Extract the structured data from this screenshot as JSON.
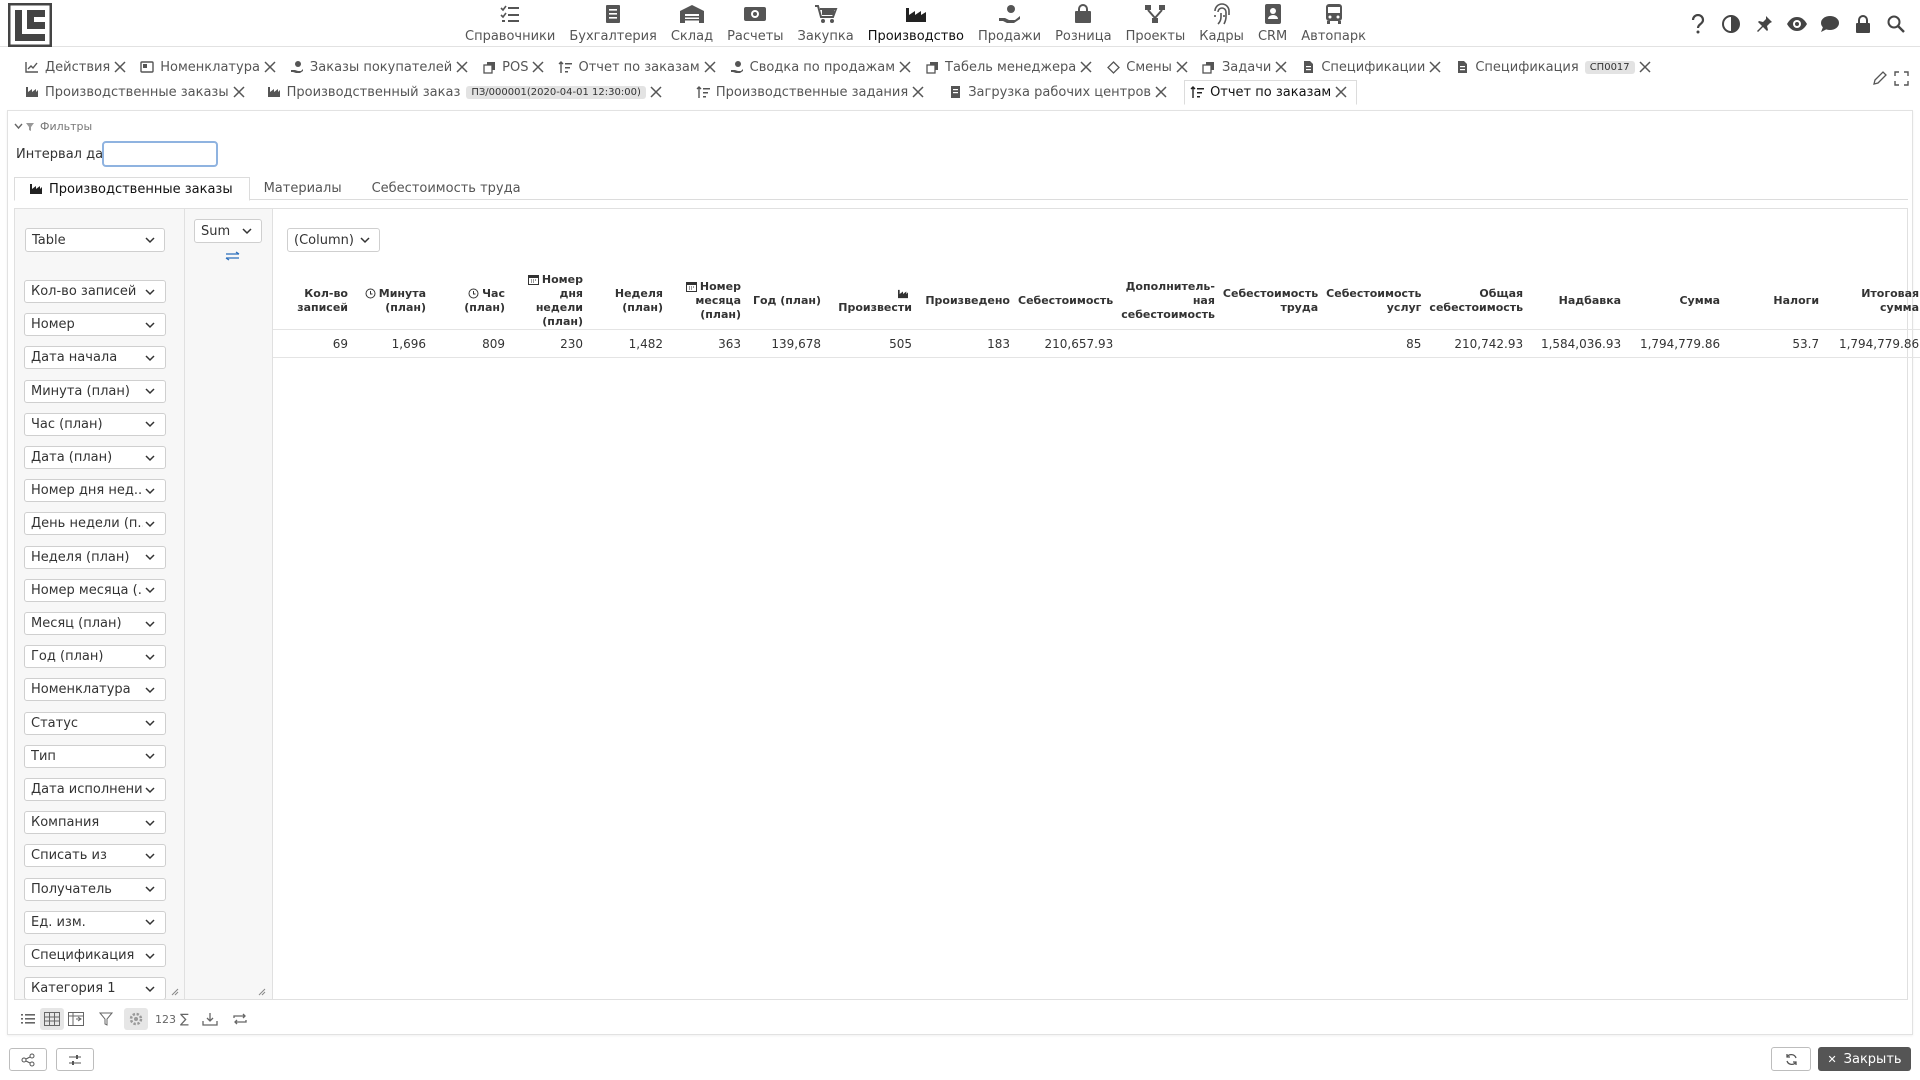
{
  "nav": {
    "items": [
      {
        "label": "Справочники",
        "icon": "list-check-icon"
      },
      {
        "label": "Бухгалтерия",
        "icon": "ledger-icon"
      },
      {
        "label": "Склад",
        "icon": "warehouse-icon"
      },
      {
        "label": "Расчеты",
        "icon": "money-icon"
      },
      {
        "label": "Закупка",
        "icon": "cart-icon"
      },
      {
        "label": "Производство",
        "icon": "factory-icon"
      },
      {
        "label": "Продажи",
        "icon": "hand-coin-icon"
      },
      {
        "label": "Розница",
        "icon": "bag-icon"
      },
      {
        "label": "Проекты",
        "icon": "network-icon"
      },
      {
        "label": "Кадры",
        "icon": "fingerprint-icon"
      },
      {
        "label": "CRM",
        "icon": "contact-card-icon"
      },
      {
        "label": "Автопарк",
        "icon": "bus-icon"
      }
    ],
    "active": "Производство"
  },
  "tabs_row1": [
    {
      "label": "Действия",
      "icon": "chart-line-icon"
    },
    {
      "label": "Номенклатура",
      "icon": "box-icon"
    },
    {
      "label": "Заказы покупателей",
      "icon": "hand-coin-icon"
    },
    {
      "label": "POS",
      "icon": "copy-icon"
    },
    {
      "label": "Отчет по заказам",
      "icon": "sort-icon"
    },
    {
      "label": "Сводка по продажам",
      "icon": "hand-coin-icon"
    },
    {
      "label": "Табель менеджера",
      "icon": "copy-icon"
    },
    {
      "label": "Смены",
      "icon": "shift-icon"
    },
    {
      "label": "Задачи",
      "icon": "copy-icon"
    },
    {
      "label": "Спецификации",
      "icon": "document-icon"
    },
    {
      "label": "Спецификация",
      "icon": "document-icon",
      "badge": "СП0017"
    }
  ],
  "tabs_row2": [
    {
      "label": "Производственные заказы",
      "icon": "factory-icon"
    },
    {
      "label": "Производственный заказ",
      "icon": "factory-icon",
      "badge": "ПЗ/000001(2020-04-01 12:30:00)"
    },
    {
      "label": "Производственные задания",
      "icon": "sort-icon"
    },
    {
      "label": "Загрузка рабочих центров",
      "icon": "ledger-icon"
    },
    {
      "label": "Отчет по заказам",
      "icon": "sort-icon",
      "active": true
    }
  ],
  "filters": {
    "toggle_label": "Фильтры",
    "date_label": "Интервал дат",
    "date_value": ""
  },
  "subtabs": [
    {
      "label": "Производственные заказы",
      "active": true
    },
    {
      "label": "Материалы"
    },
    {
      "label": "Себестоимость труда"
    }
  ],
  "pivot": {
    "renderer": "Table",
    "aggregator": "Sum",
    "column_field": "(Column)",
    "attributes": [
      "Кол-во записей",
      "Номер",
      "Дата начала",
      "Минута (план)",
      "Час (план)",
      "Дата (план)",
      "Номер дня нед...",
      "День недели (п...",
      "Неделя (план)",
      "Номер месяца (...",
      "Месяц (план)",
      "Год (план)",
      "Номенклатура",
      "Статус",
      "Тип",
      "Дата исполнения",
      "Компания",
      "Списать из",
      "Получатель",
      "Ед. изм.",
      "Спецификация",
      "Категория 1"
    ],
    "table": {
      "headers": [
        {
          "label": "Кол-во записей"
        },
        {
          "label": "Минута (план)",
          "icon": "clock-icon"
        },
        {
          "label": "Час (план)",
          "icon": "clock-icon"
        },
        {
          "label": "Номер дня недели (план)",
          "icon": "calendar-icon"
        },
        {
          "label": "Неделя (план)"
        },
        {
          "label": "Номер месяца (план)",
          "icon": "calendar-icon"
        },
        {
          "label": "Год (план)"
        },
        {
          "label": "Произвести",
          "icon": "factory-icon"
        },
        {
          "label": "Произведено"
        },
        {
          "label": "Себестоимость"
        },
        {
          "label": "Дополнитель-ная себестоимость"
        },
        {
          "label": "Себестоимость труда"
        },
        {
          "label": "Себестоимость услуг"
        },
        {
          "label": "Общая себестоимость"
        },
        {
          "label": "Надбавка"
        },
        {
          "label": "Сумма"
        },
        {
          "label": "Налоги"
        },
        {
          "label": "Итоговая сумма"
        }
      ],
      "row": [
        "69",
        "1,696",
        "809",
        "230",
        "1,482",
        "363",
        "139,678",
        "505",
        "183",
        "210,657.93",
        "",
        "",
        "85",
        "210,742.93",
        "1,584,036.93",
        "1,794,779.86",
        "53.7",
        "1,794,779.86"
      ]
    }
  },
  "toolbar": {
    "number_format": "123",
    "sum_symbol": "∑"
  },
  "footer": {
    "close_label": "Закрыть"
  },
  "colors": {
    "accent_input_border": "#8fb3e0",
    "close_button_bg": "#555555",
    "panel_bg": "#f7f7f7"
  }
}
